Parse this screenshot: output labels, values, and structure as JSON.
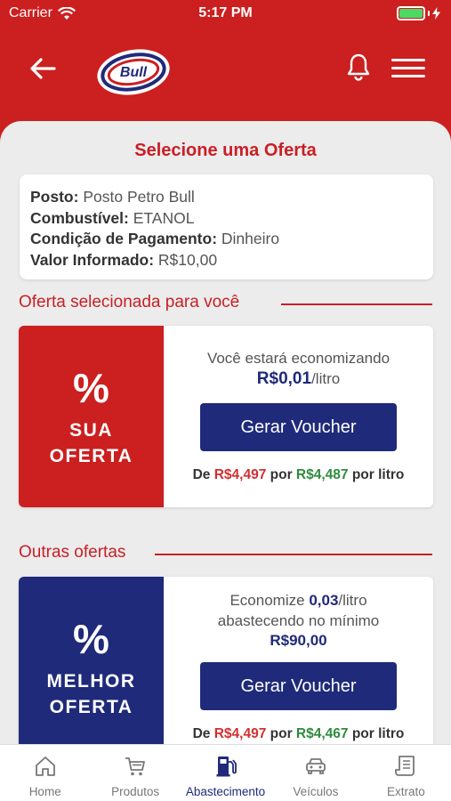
{
  "statusbar": {
    "carrier": "Carrier",
    "time": "5:17 PM"
  },
  "header": {
    "logo_text": "Bull"
  },
  "page": {
    "title": "Selecione uma Oferta"
  },
  "info": {
    "posto_label": "Posto:",
    "posto_value": "Posto Petro Bull",
    "combustivel_label": "Combustível:",
    "combustivel_value": "ETANOL",
    "pagamento_label": "Condição de Pagamento:",
    "pagamento_value": "Dinheiro",
    "valor_label": "Valor Informado:",
    "valor_value": "R$10,00"
  },
  "selected_section": {
    "title": "Oferta selecionada para você"
  },
  "selected_offer": {
    "pct": "%",
    "badge_line1": "SUA",
    "badge_line2": "OFERTA",
    "line1": "Você estará economizando",
    "amount": "R$0,01",
    "unit": "/litro",
    "button": "Gerar Voucher",
    "de": "De",
    "old_price": "R$4,497",
    "por": "por",
    "new_price": "R$4,487",
    "por_litro": "por litro"
  },
  "other_section": {
    "title": "Outras ofertas"
  },
  "other_offer": {
    "pct": "%",
    "badge_line1": "MELHOR",
    "badge_line2": "OFERTA",
    "economize": "Economize",
    "amount": "0,03",
    "unit": "/litro",
    "line2": "abastecendo no mínimo",
    "minimum": "R$90,00",
    "button": "Gerar Voucher",
    "de": "De",
    "old_price": "R$4,497",
    "por": "por",
    "new_price": "R$4,467",
    "por_litro": "por litro"
  },
  "tabs": [
    {
      "label": "Home",
      "icon": "home-icon"
    },
    {
      "label": "Produtos",
      "icon": "cart-icon"
    },
    {
      "label": "Abastecimento",
      "icon": "fuel-pump-icon",
      "active": true
    },
    {
      "label": "Veículos",
      "icon": "car-icon"
    },
    {
      "label": "Extrato",
      "icon": "receipt-icon"
    }
  ],
  "colors": {
    "brand_red": "#cc1f1f",
    "brand_blue": "#1f2a7a",
    "price_old": "#d32f2f",
    "price_new": "#2e8b3e",
    "battery": "#4cd964"
  }
}
